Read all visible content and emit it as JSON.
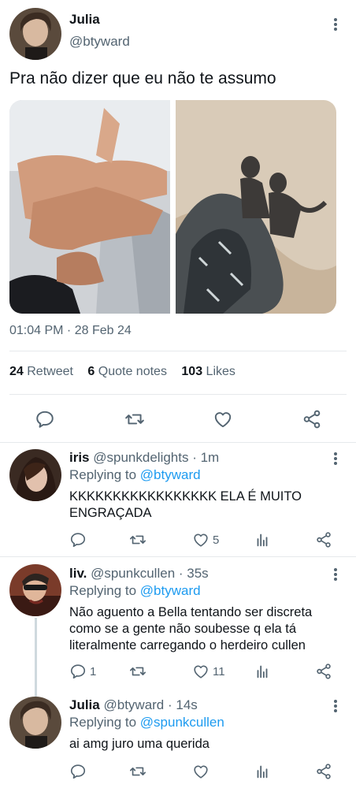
{
  "main_tweet": {
    "name": "Julia",
    "handle": "@btyward",
    "text": "Pra não dizer que eu não te assumo",
    "timestamp": "01:04 PM · 28 Feb 24",
    "stats": {
      "retweets_count": "24",
      "retweets_label": "Retweet",
      "quotes_count": "6",
      "quotes_label": "Quote notes",
      "likes_count": "103",
      "likes_label": "Likes"
    }
  },
  "replies": [
    {
      "name": "iris",
      "handle": "@spunkdelights",
      "time": "· 1m",
      "replying_label": "Replying to",
      "replying_to": "@btyward",
      "text": "KKKKKKKKKKKKKKKKK ELA É MUITO ENGRAÇADA",
      "reply_count": "",
      "like_count": "5"
    },
    {
      "name": "liv.",
      "handle": "@spunkcullen",
      "time": "· 35s",
      "replying_label": "Replying to",
      "replying_to": "@btyward",
      "text": "Não aguento a Bella tentando ser discreta como se a gente não soubesse q ela tá literalmente carregando o herdeiro cullen",
      "reply_count": "1",
      "like_count": "11"
    },
    {
      "name": "Julia",
      "handle": "@btyward",
      "time": "· 14s",
      "replying_label": "Replying to",
      "replying_to": "@spunkcullen",
      "text": "ai amg juro uma querida",
      "reply_count": "",
      "like_count": ""
    }
  ],
  "colors": {
    "link": "#1d9bf0",
    "secondary_text": "#536471",
    "primary_text": "#0f1419",
    "icon": "#536471"
  },
  "icons": [
    "more-vertical-icon",
    "reply-icon",
    "retweet-icon",
    "like-icon",
    "share-icon",
    "analytics-icon"
  ]
}
